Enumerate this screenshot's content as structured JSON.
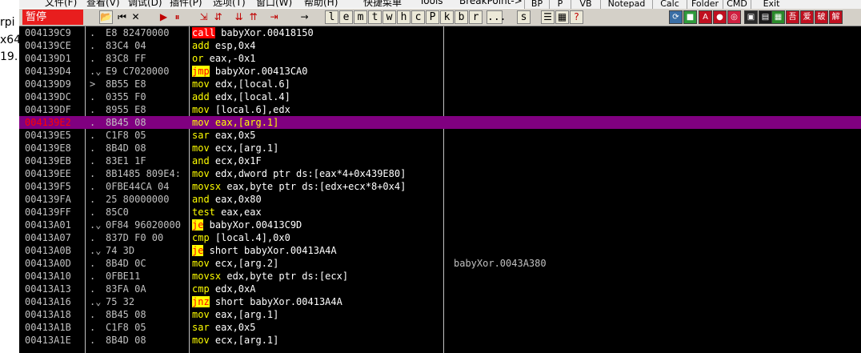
{
  "left_window": {
    "fragments": [
      "rpi",
      "x64",
      "19."
    ]
  },
  "menubar": {
    "items": [
      "文件(F)",
      "查看(V)",
      "调试(D)",
      "插件(P)",
      "选项(T)",
      "窗口(W)",
      "帮助(H)",
      "快捷菜单",
      "Tools",
      "BreakPoint->"
    ]
  },
  "plugin_menu": {
    "items": [
      "BP",
      "P",
      "VB",
      "Notepad",
      "Calc",
      "Folder",
      "CMD",
      "Exit"
    ]
  },
  "toolbar": {
    "status_label": "暂停",
    "letter_buttons": [
      "l",
      "e",
      "m",
      "t",
      "w",
      "h",
      "c",
      "P",
      "k",
      "b",
      "r",
      "...",
      "s"
    ],
    "cn_buttons": [
      "吾",
      "爱",
      "破",
      "解"
    ],
    "colors": {
      "status_bg": "#e81e1e",
      "toolbar_bg": "#d4d0c8"
    }
  },
  "disassembly": {
    "selected_row": 7,
    "colors": {
      "background": "#000000",
      "selected": "#800080",
      "mnemonic": "#ffff00",
      "operand": "#ffffff",
      "address": "#c0c0c0"
    },
    "rows": [
      {
        "addr": "004139C9",
        "mark": ".",
        "hex": "E8 82470000",
        "mn": "call",
        "ops": " babyXor.00418150",
        "style": "call",
        "cmt": ""
      },
      {
        "addr": "004139CE",
        "mark": ".",
        "hex": "83C4 04",
        "mn": "add",
        "ops": " esp,0x4",
        "style": "",
        "cmt": ""
      },
      {
        "addr": "004139D1",
        "mark": ".",
        "hex": "83C8 FF",
        "mn": "or",
        "ops": " eax,-0x1",
        "style": "",
        "cmt": ""
      },
      {
        "addr": "004139D4",
        "mark": ".⌄",
        "hex": "E9 C7020000",
        "mn": "jmp",
        "ops": " babyXor.00413CA0",
        "style": "box",
        "cmt": ""
      },
      {
        "addr": "004139D9",
        "mark": ">",
        "hex": "8B55 E8",
        "mn": "mov",
        "ops": " edx,[local.6]",
        "style": "",
        "cmt": ""
      },
      {
        "addr": "004139DC",
        "mark": ".",
        "hex": "0355 F0",
        "mn": "add",
        "ops": " edx,[local.4]",
        "style": "",
        "cmt": ""
      },
      {
        "addr": "004139DF",
        "mark": ".",
        "hex": "8955 E8",
        "mn": "mov",
        "ops": " [local.6],edx",
        "style": "",
        "cmt": ""
      },
      {
        "addr": "004139E2",
        "mark": ".",
        "hex": "8B45 08",
        "mn": "mov",
        "ops": " eax,[arg.1]",
        "style": "",
        "cmt": ""
      },
      {
        "addr": "004139E5",
        "mark": ".",
        "hex": "C1F8 05",
        "mn": "sar",
        "ops": " eax,0x5",
        "style": "",
        "cmt": ""
      },
      {
        "addr": "004139E8",
        "mark": ".",
        "hex": "8B4D 08",
        "mn": "mov",
        "ops": " ecx,[arg.1]",
        "style": "",
        "cmt": ""
      },
      {
        "addr": "004139EB",
        "mark": ".",
        "hex": "83E1 1F",
        "mn": "and",
        "ops": " ecx,0x1F",
        "style": "",
        "cmt": ""
      },
      {
        "addr": "004139EE",
        "mark": ".",
        "hex": "8B1485 809E4:",
        "mn": "mov",
        "ops": " edx,dword ptr ds:[eax*4+0x439E80]",
        "style": "",
        "cmt": ""
      },
      {
        "addr": "004139F5",
        "mark": ".",
        "hex": "0FBE44CA 04",
        "mn": "movsx",
        "ops": " eax,byte ptr ds:[edx+ecx*8+0x4]",
        "style": "",
        "cmt": ""
      },
      {
        "addr": "004139FA",
        "mark": ".",
        "hex": "25 80000000",
        "mn": "and",
        "ops": " eax,0x80",
        "style": "",
        "cmt": ""
      },
      {
        "addr": "004139FF",
        "mark": ".",
        "hex": "85C0",
        "mn": "test",
        "ops": " eax,eax",
        "style": "",
        "cmt": ""
      },
      {
        "addr": "00413A01",
        "mark": ".⌄",
        "hex": "0F84 96020000",
        "mn": "je",
        "ops": " babyXor.00413C9D",
        "style": "box",
        "cmt": ""
      },
      {
        "addr": "00413A07",
        "mark": ".",
        "hex": "837D F0 00",
        "mn": "cmp",
        "ops": " [local.4],0x0",
        "style": "",
        "cmt": ""
      },
      {
        "addr": "00413A0B",
        "mark": ".⌄",
        "hex": "74 3D",
        "mn": "je",
        "ops": " short babyXor.00413A4A",
        "style": "box",
        "cmt": ""
      },
      {
        "addr": "00413A0D",
        "mark": ".",
        "hex": "8B4D 0C",
        "mn": "mov",
        "ops": " ecx,[arg.2]",
        "style": "",
        "cmt": "babyXor.0043A380"
      },
      {
        "addr": "00413A10",
        "mark": ".",
        "hex": "0FBE11",
        "mn": "movsx",
        "ops": " edx,byte ptr ds:[ecx]",
        "style": "",
        "cmt": ""
      },
      {
        "addr": "00413A13",
        "mark": ".",
        "hex": "83FA 0A",
        "mn": "cmp",
        "ops": " edx,0xA",
        "style": "",
        "cmt": ""
      },
      {
        "addr": "00413A16",
        "mark": ".⌄",
        "hex": "75 32",
        "mn": "jnz",
        "ops": " short babyXor.00413A4A",
        "style": "box",
        "cmt": ""
      },
      {
        "addr": "00413A18",
        "mark": ".",
        "hex": "8B45 08",
        "mn": "mov",
        "ops": " eax,[arg.1]",
        "style": "",
        "cmt": ""
      },
      {
        "addr": "00413A1B",
        "mark": ".",
        "hex": "C1F8 05",
        "mn": "sar",
        "ops": " eax,0x5",
        "style": "",
        "cmt": ""
      },
      {
        "addr": "00413A1E",
        "mark": ".",
        "hex": "8B4D 08",
        "mn": "mov",
        "ops": " ecx,[arg.1]",
        "style": "",
        "cmt": ""
      }
    ]
  }
}
